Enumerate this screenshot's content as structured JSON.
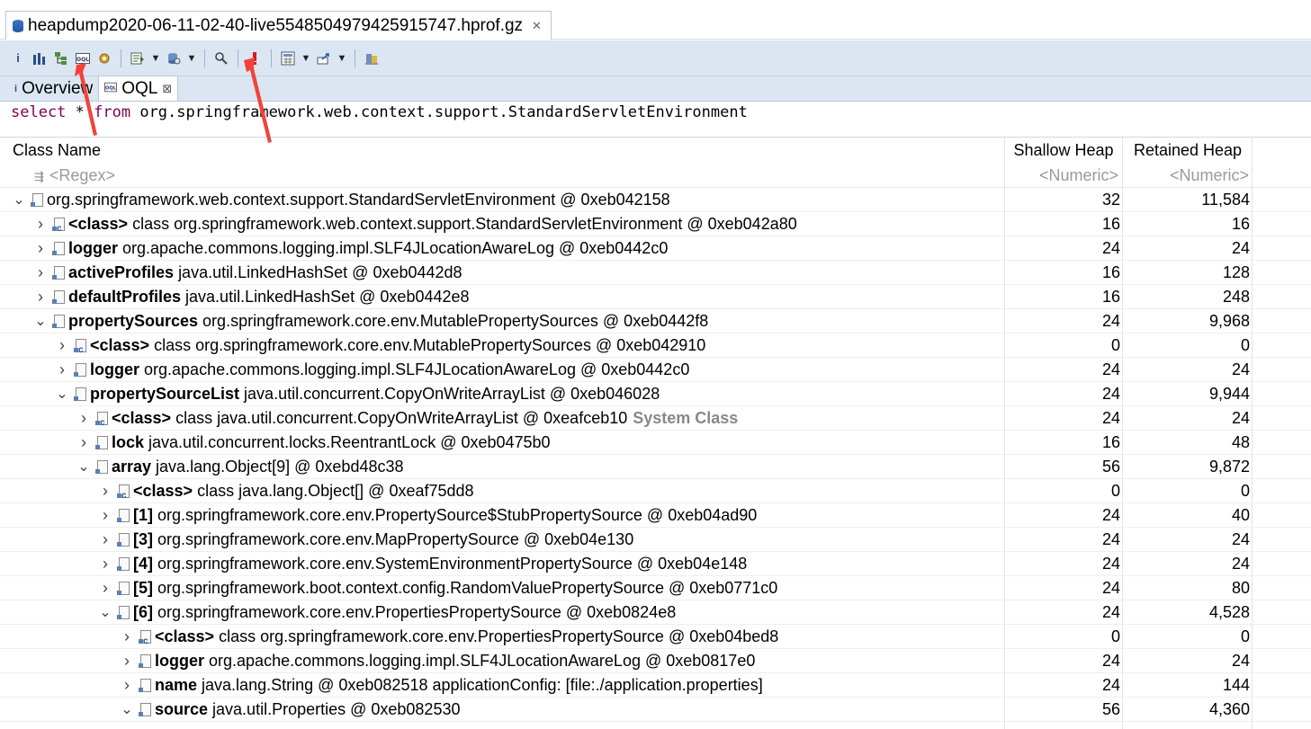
{
  "editor": {
    "tab_title": "heapdump2020-06-11-02-40-live5548504979425915747.hprof.gz",
    "close_glyph": "✕"
  },
  "toolbar": {
    "buttons": [
      {
        "name": "info-button",
        "glyph": "i"
      },
      {
        "name": "histogram-button",
        "glyph": "Ⅲ"
      },
      {
        "name": "dominator-tree-button",
        "glyph": "⊞"
      },
      {
        "name": "oql-button",
        "glyph": "OQL"
      },
      {
        "name": "thread-overview-button",
        "glyph": "⚙"
      }
    ]
  },
  "subtabs": {
    "overview_label": "Overview",
    "oql_label": "OQL",
    "oql_icon_text": "OQL",
    "close_glyph": "⊠"
  },
  "query": {
    "kw_select": "select",
    "star": " * ",
    "kw_from": "from",
    "class_name": " org.springframework.web.context.support.StandardServletEnvironment"
  },
  "table": {
    "headers": {
      "class_name": "Class Name",
      "shallow_heap": "Shallow Heap",
      "retained_heap": "Retained Heap"
    },
    "filters": {
      "name": "<Regex>",
      "shallow": "<Numeric>",
      "retained": "<Numeric>"
    },
    "rows": [
      {
        "depth": 0,
        "expanded": true,
        "icon": "obj",
        "field": "",
        "text": "org.springframework.web.context.support.StandardServletEnvironment @ 0xeb042158",
        "sys": "",
        "shallow": "32",
        "retained": "11,584"
      },
      {
        "depth": 1,
        "expanded": false,
        "icon": "cls",
        "field": "<class>",
        "text": "class org.springframework.web.context.support.StandardServletEnvironment @ 0xeb042a80",
        "sys": "",
        "shallow": "16",
        "retained": "16"
      },
      {
        "depth": 1,
        "expanded": false,
        "icon": "obj",
        "field": "logger",
        "text": "org.apache.commons.logging.impl.SLF4JLocationAwareLog @ 0xeb0442c0",
        "sys": "",
        "shallow": "24",
        "retained": "24"
      },
      {
        "depth": 1,
        "expanded": false,
        "icon": "obj",
        "field": "activeProfiles",
        "text": "java.util.LinkedHashSet @ 0xeb0442d8",
        "sys": "",
        "shallow": "16",
        "retained": "128"
      },
      {
        "depth": 1,
        "expanded": false,
        "icon": "obj",
        "field": "defaultProfiles",
        "text": "java.util.LinkedHashSet @ 0xeb0442e8",
        "sys": "",
        "shallow": "16",
        "retained": "248"
      },
      {
        "depth": 1,
        "expanded": true,
        "icon": "obj",
        "field": "propertySources",
        "text": "org.springframework.core.env.MutablePropertySources @ 0xeb0442f8",
        "sys": "",
        "shallow": "24",
        "retained": "9,968"
      },
      {
        "depth": 2,
        "expanded": false,
        "icon": "cls",
        "field": "<class>",
        "text": "class org.springframework.core.env.MutablePropertySources @ 0xeb042910",
        "sys": "",
        "shallow": "0",
        "retained": "0"
      },
      {
        "depth": 2,
        "expanded": false,
        "icon": "obj",
        "field": "logger",
        "text": "org.apache.commons.logging.impl.SLF4JLocationAwareLog @ 0xeb0442c0",
        "sys": "",
        "shallow": "24",
        "retained": "24"
      },
      {
        "depth": 2,
        "expanded": true,
        "icon": "obj",
        "field": "propertySourceList",
        "text": "java.util.concurrent.CopyOnWriteArrayList @ 0xeb046028",
        "sys": "",
        "shallow": "24",
        "retained": "9,944"
      },
      {
        "depth": 3,
        "expanded": false,
        "icon": "cls",
        "field": "<class>",
        "text": "class java.util.concurrent.CopyOnWriteArrayList @ 0xeafceb10",
        "sys": "System Class",
        "shallow": "24",
        "retained": "24"
      },
      {
        "depth": 3,
        "expanded": false,
        "icon": "obj",
        "field": "lock",
        "text": "java.util.concurrent.locks.ReentrantLock @ 0xeb0475b0",
        "sys": "",
        "shallow": "16",
        "retained": "48"
      },
      {
        "depth": 3,
        "expanded": true,
        "icon": "obj",
        "field": "array",
        "text": "java.lang.Object[9] @ 0xebd48c38",
        "sys": "",
        "shallow": "56",
        "retained": "9,872"
      },
      {
        "depth": 4,
        "expanded": false,
        "icon": "cls",
        "field": "<class>",
        "text": "class java.lang.Object[] @ 0xeaf75dd8",
        "sys": "",
        "shallow": "0",
        "retained": "0"
      },
      {
        "depth": 4,
        "expanded": false,
        "icon": "obj",
        "field": "[1]",
        "text": "org.springframework.core.env.PropertySource$StubPropertySource @ 0xeb04ad90",
        "sys": "",
        "shallow": "24",
        "retained": "40"
      },
      {
        "depth": 4,
        "expanded": false,
        "icon": "obj",
        "field": "[3]",
        "text": "org.springframework.core.env.MapPropertySource @ 0xeb04e130",
        "sys": "",
        "shallow": "24",
        "retained": "24"
      },
      {
        "depth": 4,
        "expanded": false,
        "icon": "obj",
        "field": "[4]",
        "text": "org.springframework.core.env.SystemEnvironmentPropertySource @ 0xeb04e148",
        "sys": "",
        "shallow": "24",
        "retained": "24"
      },
      {
        "depth": 4,
        "expanded": false,
        "icon": "obj",
        "field": "[5]",
        "text": "org.springframework.boot.context.config.RandomValuePropertySource @ 0xeb0771c0",
        "sys": "",
        "shallow": "24",
        "retained": "80"
      },
      {
        "depth": 4,
        "expanded": true,
        "icon": "obj",
        "field": "[6]",
        "text": "org.springframework.core.env.PropertiesPropertySource @ 0xeb0824e8",
        "sys": "",
        "shallow": "24",
        "retained": "4,528"
      },
      {
        "depth": 5,
        "expanded": false,
        "icon": "cls",
        "field": "<class>",
        "text": "class org.springframework.core.env.PropertiesPropertySource @ 0xeb04bed8",
        "sys": "",
        "shallow": "0",
        "retained": "0"
      },
      {
        "depth": 5,
        "expanded": false,
        "icon": "obj",
        "field": "logger",
        "text": "org.apache.commons.logging.impl.SLF4JLocationAwareLog @ 0xeb0817e0",
        "sys": "",
        "shallow": "24",
        "retained": "24"
      },
      {
        "depth": 5,
        "expanded": false,
        "icon": "obj",
        "field": "name",
        "text": "java.lang.String @ 0xeb082518  applicationConfig: [file:./application.properties]",
        "sys": "",
        "shallow": "24",
        "retained": "144"
      },
      {
        "depth": 5,
        "expanded": true,
        "icon": "obj",
        "field": "source",
        "text": "java.util.Properties @ 0xeb082530",
        "sys": "",
        "shallow": "56",
        "retained": "4,360"
      }
    ]
  },
  "colors": {
    "annotation_arrow": "#f0443a",
    "toolbar_bg": "#dbe6f2",
    "oql_keyword": "#7f0055"
  }
}
